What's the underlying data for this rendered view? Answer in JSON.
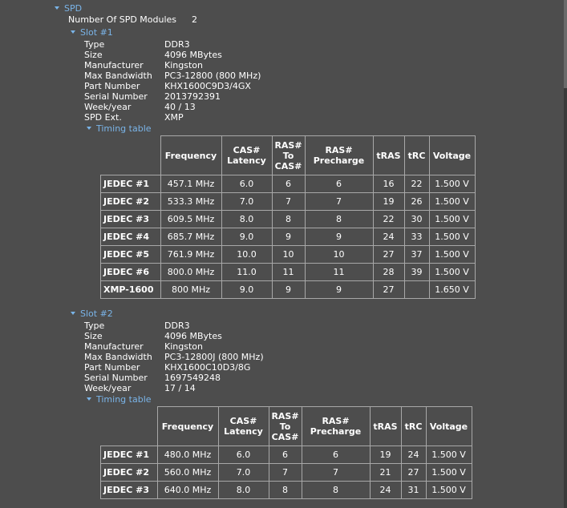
{
  "spd": {
    "title": "SPD",
    "modules_label": "Number Of SPD Modules",
    "modules_value": "2",
    "headers": [
      "Frequency",
      "CAS# Latency",
      "RAS# To CAS#",
      "RAS# Precharge",
      "tRAS",
      "tRC",
      "Voltage"
    ],
    "slots": [
      {
        "title": "Slot #1",
        "props": [
          {
            "label": "Type",
            "value": "DDR3"
          },
          {
            "label": "Size",
            "value": "4096 MBytes"
          },
          {
            "label": "Manufacturer",
            "value": "Kingston"
          },
          {
            "label": "Max Bandwidth",
            "value": "PC3-12800 (800 MHz)"
          },
          {
            "label": "Part Number",
            "value": "KHX1600C9D3/4GX"
          },
          {
            "label": "Serial Number",
            "value": "2013792391"
          },
          {
            "label": "Week/year",
            "value": "40 / 13"
          },
          {
            "label": "SPD Ext.",
            "value": "XMP"
          }
        ],
        "timing_label": "Timing table",
        "rows": [
          [
            "JEDEC #1",
            "457.1 MHz",
            "6.0",
            "6",
            "6",
            "16",
            "22",
            "1.500 V"
          ],
          [
            "JEDEC #2",
            "533.3 MHz",
            "7.0",
            "7",
            "7",
            "19",
            "26",
            "1.500 V"
          ],
          [
            "JEDEC #3",
            "609.5 MHz",
            "8.0",
            "8",
            "8",
            "22",
            "30",
            "1.500 V"
          ],
          [
            "JEDEC #4",
            "685.7 MHz",
            "9.0",
            "9",
            "9",
            "24",
            "33",
            "1.500 V"
          ],
          [
            "JEDEC #5",
            "761.9 MHz",
            "10.0",
            "10",
            "10",
            "27",
            "37",
            "1.500 V"
          ],
          [
            "JEDEC #6",
            "800.0 MHz",
            "11.0",
            "11",
            "11",
            "28",
            "39",
            "1.500 V"
          ],
          [
            "XMP-1600",
            "800 MHz",
            "9.0",
            "9",
            "9",
            "27",
            "",
            "1.650 V"
          ]
        ]
      },
      {
        "title": "Slot #2",
        "props": [
          {
            "label": "Type",
            "value": "DDR3"
          },
          {
            "label": "Size",
            "value": "4096 MBytes"
          },
          {
            "label": "Manufacturer",
            "value": "Kingston"
          },
          {
            "label": "Max Bandwidth",
            "value": "PC3-12800J (800 MHz)"
          },
          {
            "label": "Part Number",
            "value": "KHX1600C10D3/8G"
          },
          {
            "label": "Serial Number",
            "value": "1697549248"
          },
          {
            "label": "Week/year",
            "value": "17 / 14"
          }
        ],
        "timing_label": "Timing table",
        "rows": [
          [
            "JEDEC #1",
            "480.0 MHz",
            "6.0",
            "6",
            "6",
            "19",
            "24",
            "1.500 V"
          ],
          [
            "JEDEC #2",
            "560.0 MHz",
            "7.0",
            "7",
            "7",
            "21",
            "27",
            "1.500 V"
          ],
          [
            "JEDEC #3",
            "640.0 MHz",
            "8.0",
            "8",
            "8",
            "24",
            "31",
            "1.500 V"
          ]
        ]
      }
    ]
  }
}
